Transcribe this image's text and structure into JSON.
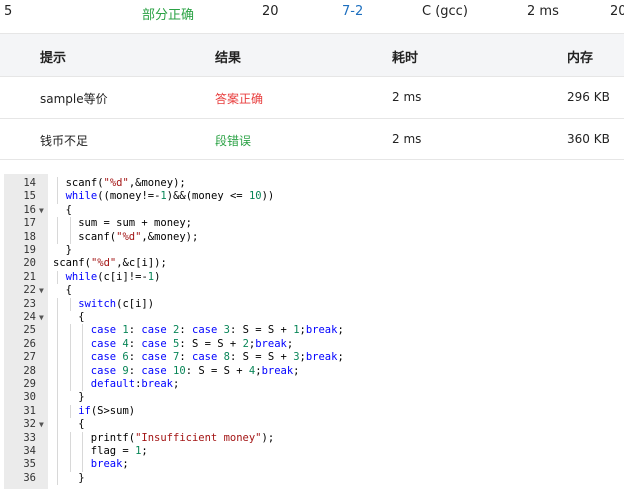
{
  "submission_row": {
    "id_fragment": "5",
    "status": "部分正确",
    "score": "20",
    "problem": "7-2",
    "compiler": "C (gcc)",
    "time": "2 ms",
    "memory_fragment": "20"
  },
  "colors": {
    "partial_green": "#2ba245",
    "link_blue": "#1d6fbf",
    "wrong_red": "#e83d3d",
    "segfault_green": "#2ba245"
  },
  "results_table": {
    "headers": [
      "提示",
      "结果",
      "耗时",
      "内存"
    ],
    "rows": [
      {
        "hint": "sample等价",
        "result": "答案正确",
        "time": "2 ms",
        "memory": "296 KB"
      },
      {
        "hint": "钱币不足",
        "result": "段错误",
        "time": "2 ms",
        "memory": "360 KB"
      }
    ]
  },
  "code_editor": {
    "lines": [
      {
        "n": "14",
        "fold": false,
        "indent": 1,
        "text": "scanf(\"%d\",&money);"
      },
      {
        "n": "15",
        "fold": false,
        "indent": 1,
        "text": "while((money!=-1)&&(money <= 10))"
      },
      {
        "n": "16",
        "fold": true,
        "indent": 1,
        "text": "{"
      },
      {
        "n": "17",
        "fold": false,
        "indent": 2,
        "text": "sum = sum + money;"
      },
      {
        "n": "18",
        "fold": false,
        "indent": 2,
        "text": "scanf(\"%d\",&money);"
      },
      {
        "n": "19",
        "fold": false,
        "indent": 1,
        "text": "}"
      },
      {
        "n": "20",
        "fold": false,
        "indent": 0,
        "text": "scanf(\"%d\",&c[i]);"
      },
      {
        "n": "21",
        "fold": false,
        "indent": 1,
        "text": "while(c[i]!=-1)"
      },
      {
        "n": "22",
        "fold": true,
        "indent": 1,
        "text": "{"
      },
      {
        "n": "23",
        "fold": false,
        "indent": 2,
        "text": "switch(c[i])"
      },
      {
        "n": "24",
        "fold": true,
        "indent": 2,
        "text": "{"
      },
      {
        "n": "25",
        "fold": false,
        "indent": 3,
        "text": "case 1: case 2: case 3: S = S + 1;break;"
      },
      {
        "n": "26",
        "fold": false,
        "indent": 3,
        "text": "case 4: case 5: S = S + 2;break;"
      },
      {
        "n": "27",
        "fold": false,
        "indent": 3,
        "text": "case 6: case 7: case 8: S = S + 3;break;"
      },
      {
        "n": "28",
        "fold": false,
        "indent": 3,
        "text": "case 9: case 10: S = S + 4;break;"
      },
      {
        "n": "29",
        "fold": false,
        "indent": 3,
        "text": "default:break;"
      },
      {
        "n": "30",
        "fold": false,
        "indent": 2,
        "text": "}"
      },
      {
        "n": "31",
        "fold": false,
        "indent": 2,
        "text": "if(S>sum)"
      },
      {
        "n": "32",
        "fold": true,
        "indent": 2,
        "text": "{"
      },
      {
        "n": "33",
        "fold": false,
        "indent": 3,
        "text": "printf(\"Insufficient money\");"
      },
      {
        "n": "34",
        "fold": false,
        "indent": 3,
        "text": "flag = 1;"
      },
      {
        "n": "35",
        "fold": false,
        "indent": 3,
        "text": "break;"
      },
      {
        "n": "36",
        "fold": false,
        "indent": 2,
        "text": "}"
      }
    ]
  }
}
